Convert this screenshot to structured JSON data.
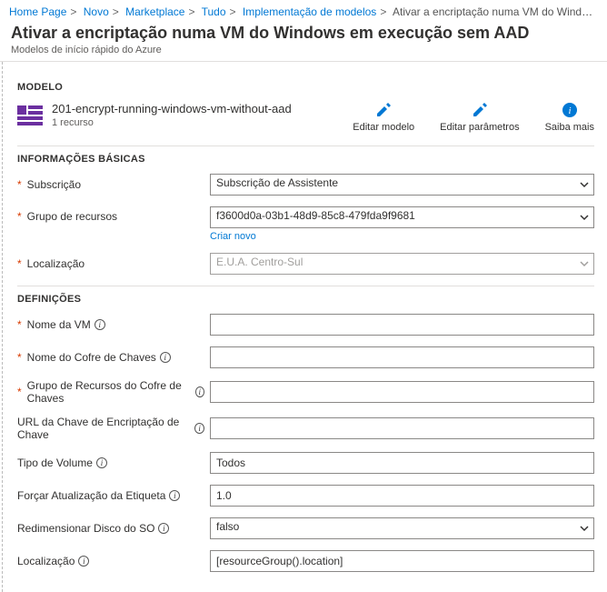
{
  "breadcrumb": {
    "items": [
      {
        "label": "Home Page"
      },
      {
        "label": "Novo"
      },
      {
        "label": "Marketplace"
      },
      {
        "label": "Tudo"
      },
      {
        "label": "Implementação de modelos"
      }
    ],
    "current": "Ativar a encriptação numa VM do Windows em execuç…"
  },
  "header": {
    "title": "Ativar a encriptação numa VM do Windows em execução sem AAD",
    "subtitle": "Modelos de início rápido do Azure"
  },
  "sections": {
    "modelo": "MODELO",
    "basicas": "INFORMAÇÕES BÁSICAS",
    "definicoes": "DEFINIÇÕES"
  },
  "template": {
    "name": "201-encrypt-running-windows-vm-without-aad",
    "resource_count": "1 recurso",
    "actions": {
      "edit_template": "Editar modelo",
      "edit_params": "Editar parâmetros",
      "learn_more": "Saiba mais"
    }
  },
  "basics": {
    "subscription": {
      "label": "Subscrição",
      "value": "Subscrição de Assistente"
    },
    "resource_group": {
      "label": "Grupo de recursos",
      "value": "f3600d0a-03b1-48d9-85c8-479fda9f9681",
      "create_new": "Criar novo"
    },
    "location": {
      "label": "Localização",
      "value": "E.U.A. Centro-Sul"
    }
  },
  "settings": {
    "vm_name": {
      "label": "Nome da VM",
      "value": ""
    },
    "kv_name": {
      "label": "Nome do Cofre de Chaves",
      "value": ""
    },
    "kv_rg": {
      "label": "Grupo de Recursos do Cofre de Chaves",
      "value": ""
    },
    "kek_url": {
      "label": "URL da Chave de Encriptação de Chave",
      "value": ""
    },
    "volume_type": {
      "label": "Tipo de Volume",
      "value": "Todos"
    },
    "force_update": {
      "label": "Forçar Atualização da Etiqueta",
      "value": "1.0"
    },
    "resize_os": {
      "label": "Redimensionar Disco do SO",
      "value": "falso"
    },
    "loc": {
      "label": "Localização",
      "value": "[resourceGroup().location]"
    }
  }
}
